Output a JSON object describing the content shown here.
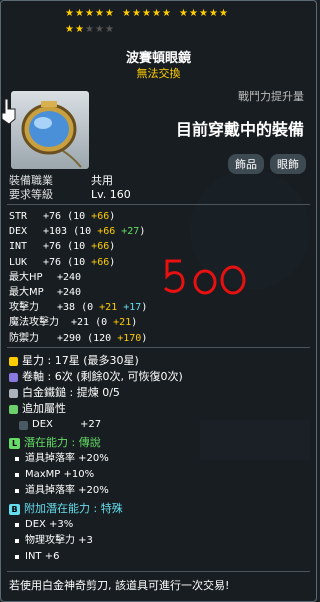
{
  "stars": {
    "row1_filled": 15,
    "row2_filled": 2,
    "row2_empty": 3
  },
  "item": {
    "name": "波賽頓眼鏡",
    "trade_status": "無法交換",
    "power_label": "戰鬥力提升量",
    "power_status": "目前穿戴中的裝備",
    "tags": [
      "飾品",
      "眼飾"
    ],
    "job_label": "裝備職業",
    "job_value": "共用",
    "level_label": "要求等級",
    "level_value": "Lv. 160"
  },
  "stats": [
    {
      "k": "STR",
      "text": "+76 (10 ",
      "y": "+66",
      "c": "",
      "end": ")"
    },
    {
      "k": "DEX",
      "text": "+103 (10 ",
      "y": "+66",
      "c": " +27",
      "end": ")"
    },
    {
      "k": "INT",
      "text": "+76 (10 ",
      "y": "+66",
      "c": "",
      "end": ")"
    },
    {
      "k": "LUK",
      "text": "+76 (10 ",
      "y": "+66",
      "c": "",
      "end": ")"
    },
    {
      "k": "最大HP",
      "text": "+240",
      "y": "",
      "c": "",
      "end": ""
    },
    {
      "k": "最大MP",
      "text": "+240",
      "y": "",
      "c": "",
      "end": ""
    },
    {
      "k": "攻擊力",
      "text": "+38 (0 ",
      "y": "+21",
      "c": " +17",
      "end": ")"
    },
    {
      "k": "魔法攻擊力",
      "text": "+21 (0 ",
      "y": "+21",
      "c": "",
      "end": ")"
    },
    {
      "k": "防禦力",
      "text": "+290 (120 ",
      "y": "+170",
      "c": "",
      "end": ")"
    }
  ],
  "handwritten": "500",
  "misc": {
    "stars_line": "星力 : 17星 (最多30星)",
    "scroll_line": "卷軸 : 6次 (剩餘0次, 可恢復0次)",
    "hammer_line": "白金鐵鎚 : 提煉 0/5",
    "extra_label": "追加屬性",
    "extra_stat": "DEX",
    "extra_value": "+27"
  },
  "potential": {
    "title": "潛在能力 : 傳說",
    "lines": [
      "道具掉落率 +20%",
      "MaxMP +10%",
      "道具掉落率 +20%"
    ]
  },
  "bonus_potential": {
    "title": "附加潛在能力 : 特殊",
    "lines": [
      "DEX +3%",
      "物理攻擊力 +3",
      "INT +6"
    ]
  },
  "footer": "若使用白金神奇剪刀, 該道具可進行一次交易!",
  "colors": {
    "legend": "#ffcc00",
    "epic": "#b46cff",
    "bonus": "#66ddee"
  }
}
